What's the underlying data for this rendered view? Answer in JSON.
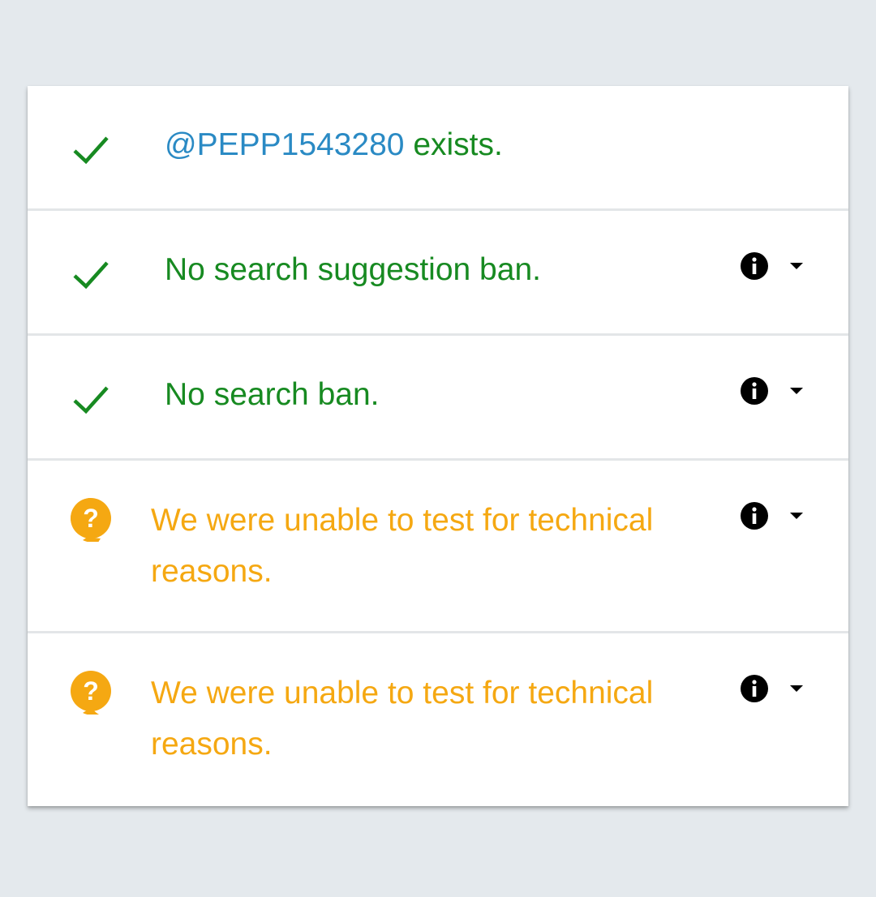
{
  "results": [
    {
      "status": "ok",
      "status_icon": "check-icon",
      "handle": "@PEPP1543280",
      "text": "exists.",
      "has_details": false
    },
    {
      "status": "ok",
      "status_icon": "check-icon",
      "text": "No search suggestion ban.",
      "has_details": true
    },
    {
      "status": "ok",
      "status_icon": "check-icon",
      "text": "No search ban.",
      "has_details": true
    },
    {
      "status": "unknown",
      "status_icon": "question-icon",
      "text": "We were unable to test for technical reasons.",
      "has_details": true
    },
    {
      "status": "unknown",
      "status_icon": "question-icon",
      "text": "We were unable to test for technical reasons.",
      "has_details": true
    }
  ],
  "colors": {
    "ok": "#178a21",
    "handle": "#2a8ac4",
    "unknown": "#f5a812",
    "background": "#e4e9ed"
  },
  "icons": {
    "details": "info-icon",
    "expand": "caret-down-icon"
  }
}
